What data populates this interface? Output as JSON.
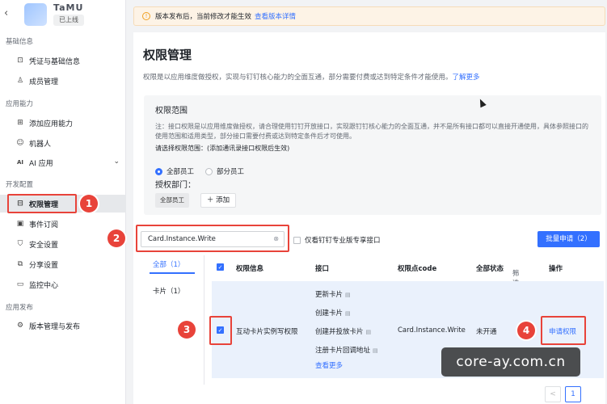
{
  "sidebar": {
    "app_name": "TaMU",
    "status": "已上线",
    "groups": {
      "basic": "基础信息",
      "capability": "应用能力",
      "dev": "开发配置",
      "release": "应用发布"
    },
    "items": {
      "credentials": "凭证与基础信息",
      "members": "成员管理",
      "add_capability": "添加应用能力",
      "robot": "机器人",
      "ai_app": "AI 应用",
      "permissions": "权限管理",
      "events": "事件订阅",
      "security": "安全设置",
      "share": "分享设置",
      "monitor": "监控中心",
      "versions": "版本管理与发布"
    }
  },
  "notice": {
    "text": "版本发布后，当前修改才能生效",
    "link": "查看版本详情"
  },
  "main": {
    "title": "权限管理",
    "desc": "权限是以应用维度做授权，实现与钉钉核心能力的全面互通，部分需要付费或达到特定条件才能使用。",
    "desc_link": "了解更多",
    "scope": {
      "title": "权限范围",
      "note": "注：接口权限是以应用维度做授权，请合理使用钉钉开放接口，实现跟钉钉核心能力的全面互通，并不是所有接口都可以直接开通使用，具体参照接口的使用范围和适用类型，部分接口需要付费或达到特定条件后才可使用。",
      "choose": "请选择权限范围：(添加通讯录接口权限后生效)",
      "radio_all": "全部员工",
      "radio_part": "部分员工",
      "dept_label": "授权部门：",
      "dept_tag": "全部员工",
      "add": "＋ 添加"
    },
    "search_value": "Card.Instance.Write",
    "only_pro": "仅看钉钉专业版专享接口",
    "batch": "批量申请（2）",
    "categories": {
      "all": "全部（1）",
      "card": "卡片（1）"
    },
    "table": {
      "headers": {
        "info": "权限信息",
        "api": "接口",
        "code": "权限点code",
        "state": "全部状态",
        "filter": "筛选",
        "action": "操作"
      },
      "row": {
        "name": "互动卡片实例写权限",
        "apis": [
          "更新卡片",
          "创建卡片",
          "创建并投放卡片",
          "注册卡片回调地址"
        ],
        "more": "查看更多",
        "code": "Card.Instance.Write",
        "state": "未开通",
        "action": "申请权限"
      }
    },
    "pager": {
      "prev": "<",
      "page": "1"
    }
  },
  "badges": [
    "1",
    "2",
    "3",
    "4"
  ],
  "watermark": "core-ay.com.cn",
  "colors": {
    "accent": "#3370ff",
    "annotation": "#e8433a"
  }
}
